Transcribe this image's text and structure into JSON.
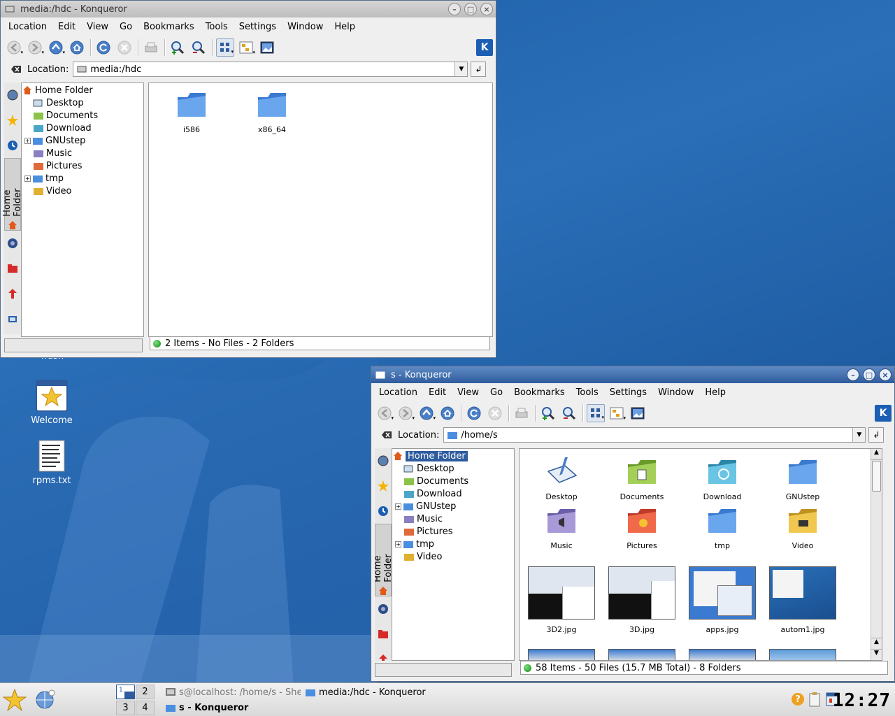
{
  "desktop": {
    "icons": [
      {
        "label": "Trash"
      },
      {
        "label": "Welcome"
      },
      {
        "label": "rpms.txt"
      }
    ]
  },
  "window1": {
    "title": "media:/hdc - Konqueror",
    "menu": [
      "Location",
      "Edit",
      "View",
      "Go",
      "Bookmarks",
      "Tools",
      "Settings",
      "Window",
      "Help"
    ],
    "location_label": "Location:",
    "location_value": "media:/hdc",
    "sidebar_tab_label": "Home Folder",
    "tree": [
      {
        "label": "Home Folder",
        "expand": ""
      },
      {
        "label": "Desktop",
        "expand": ""
      },
      {
        "label": "Documents",
        "expand": ""
      },
      {
        "label": "Download",
        "expand": ""
      },
      {
        "label": "GNUstep",
        "expand": "+"
      },
      {
        "label": "Music",
        "expand": ""
      },
      {
        "label": "Pictures",
        "expand": ""
      },
      {
        "label": "tmp",
        "expand": "+"
      },
      {
        "label": "Video",
        "expand": ""
      }
    ],
    "files": [
      {
        "label": "i586"
      },
      {
        "label": "x86_64"
      }
    ],
    "status": "2 Items - No Files - 2 Folders"
  },
  "window2": {
    "title": "s - Konqueror",
    "menu": [
      "Location",
      "Edit",
      "View",
      "Go",
      "Bookmarks",
      "Tools",
      "Settings",
      "Window",
      "Help"
    ],
    "location_label": "Location:",
    "location_value": "/home/s",
    "sidebar_tab_label": "Home Folder",
    "tree": [
      {
        "label": "Home Folder",
        "expand": ""
      },
      {
        "label": "Desktop",
        "expand": ""
      },
      {
        "label": "Documents",
        "expand": ""
      },
      {
        "label": "Download",
        "expand": ""
      },
      {
        "label": "GNUstep",
        "expand": "+"
      },
      {
        "label": "Music",
        "expand": ""
      },
      {
        "label": "Pictures",
        "expand": ""
      },
      {
        "label": "tmp",
        "expand": "+"
      },
      {
        "label": "Video",
        "expand": ""
      }
    ],
    "folders": [
      {
        "label": "Desktop"
      },
      {
        "label": "Documents"
      },
      {
        "label": "Download"
      },
      {
        "label": "GNUstep"
      },
      {
        "label": "Music"
      },
      {
        "label": "Pictures"
      },
      {
        "label": "tmp"
      },
      {
        "label": "Video"
      }
    ],
    "images": [
      {
        "label": "3D2.jpg"
      },
      {
        "label": "3D.jpg"
      },
      {
        "label": "apps.jpg"
      },
      {
        "label": "autom1.jpg"
      }
    ],
    "status": "58 Items - 50 Files (15.7 MB Total) - 8 Folders"
  },
  "taskbar": {
    "pager": [
      "1",
      "2",
      "3",
      "4"
    ],
    "tasks": [
      {
        "label": "s@localhost: /home/s - She"
      },
      {
        "label": "media:/hdc - Konqueror"
      },
      {
        "label": "s - Konqueror"
      }
    ],
    "clock": "12:27"
  },
  "colors": {
    "desktop_bg": "#1e5fa8",
    "active_title": "#2e5c9e",
    "selection": "#2e5c9e",
    "folder_blue": "#4a8ee0"
  }
}
